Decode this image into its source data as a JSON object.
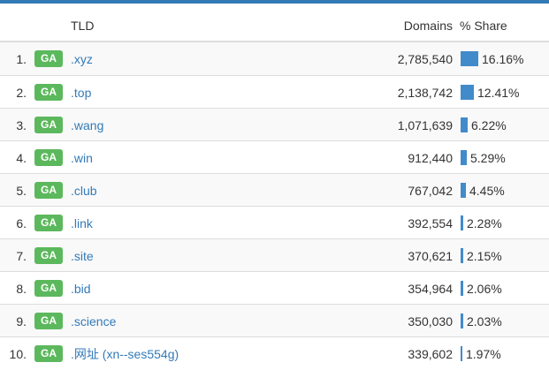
{
  "table": {
    "headers": {
      "tld": "TLD",
      "domains": "Domains",
      "share": "% Share"
    },
    "badge_color": "#5cb85c",
    "link_color": "#337ab7",
    "bar_color": "#428bca",
    "rows": [
      {
        "rank": "1.",
        "badge": "GA",
        "tld": ".xyz",
        "domains": "2,785,540",
        "share": "16.16%",
        "share_value": 16.16
      },
      {
        "rank": "2.",
        "badge": "GA",
        "tld": ".top",
        "domains": "2,138,742",
        "share": "12.41%",
        "share_value": 12.41
      },
      {
        "rank": "3.",
        "badge": "GA",
        "tld": ".wang",
        "domains": "1,071,639",
        "share": "6.22%",
        "share_value": 6.22
      },
      {
        "rank": "4.",
        "badge": "GA",
        "tld": ".win",
        "domains": "912,440",
        "share": "5.29%",
        "share_value": 5.29
      },
      {
        "rank": "5.",
        "badge": "GA",
        "tld": ".club",
        "domains": "767,042",
        "share": "4.45%",
        "share_value": 4.45
      },
      {
        "rank": "6.",
        "badge": "GA",
        "tld": ".link",
        "domains": "392,554",
        "share": "2.28%",
        "share_value": 2.28
      },
      {
        "rank": "7.",
        "badge": "GA",
        "tld": ".site",
        "domains": "370,621",
        "share": "2.15%",
        "share_value": 2.15
      },
      {
        "rank": "8.",
        "badge": "GA",
        "tld": ".bid",
        "domains": "354,964",
        "share": "2.06%",
        "share_value": 2.06
      },
      {
        "rank": "9.",
        "badge": "GA",
        "tld": ".science",
        "domains": "350,030",
        "share": "2.03%",
        "share_value": 2.03
      },
      {
        "rank": "10.",
        "badge": "GA",
        "tld": ".网址 (xn--ses554g)",
        "domains": "339,602",
        "share": "1.97%",
        "share_value": 1.97
      }
    ]
  }
}
